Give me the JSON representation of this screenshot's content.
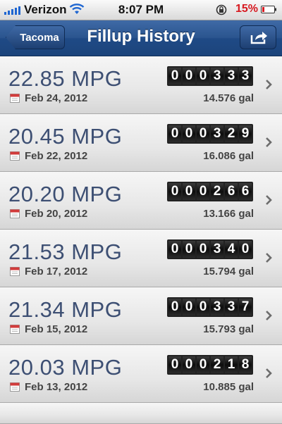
{
  "status": {
    "carrier": "Verizon",
    "time": "8:07 PM",
    "battery_pct": "15%"
  },
  "nav": {
    "back_label": "Tacoma",
    "title": "Fillup History"
  },
  "fillups": [
    {
      "mpg": "22.85 MPG",
      "date": "Feb 24, 2012",
      "odometer": "000333",
      "gallons": "14.576 gal"
    },
    {
      "mpg": "20.45 MPG",
      "date": "Feb 22, 2012",
      "odometer": "000329",
      "gallons": "16.086 gal"
    },
    {
      "mpg": "20.20 MPG",
      "date": "Feb 20, 2012",
      "odometer": "000266",
      "gallons": "13.166 gal"
    },
    {
      "mpg": "21.53 MPG",
      "date": "Feb 17, 2012",
      "odometer": "000340",
      "gallons": "15.794 gal"
    },
    {
      "mpg": "21.34 MPG",
      "date": "Feb 15, 2012",
      "odometer": "000337",
      "gallons": "15.793 gal"
    },
    {
      "mpg": "20.03 MPG",
      "date": "Feb 13, 2012",
      "odometer": "000218",
      "gallons": "10.885 gal"
    }
  ],
  "colors": {
    "nav_blue": "#2a548e",
    "mpg_text": "#3d4f73",
    "battery_red": "#d71920"
  },
  "icons": [
    "signal-bars-icon",
    "wifi-icon",
    "rotation-lock-icon",
    "battery-icon",
    "share-icon",
    "calendar-icon",
    "chevron-right-icon"
  ]
}
